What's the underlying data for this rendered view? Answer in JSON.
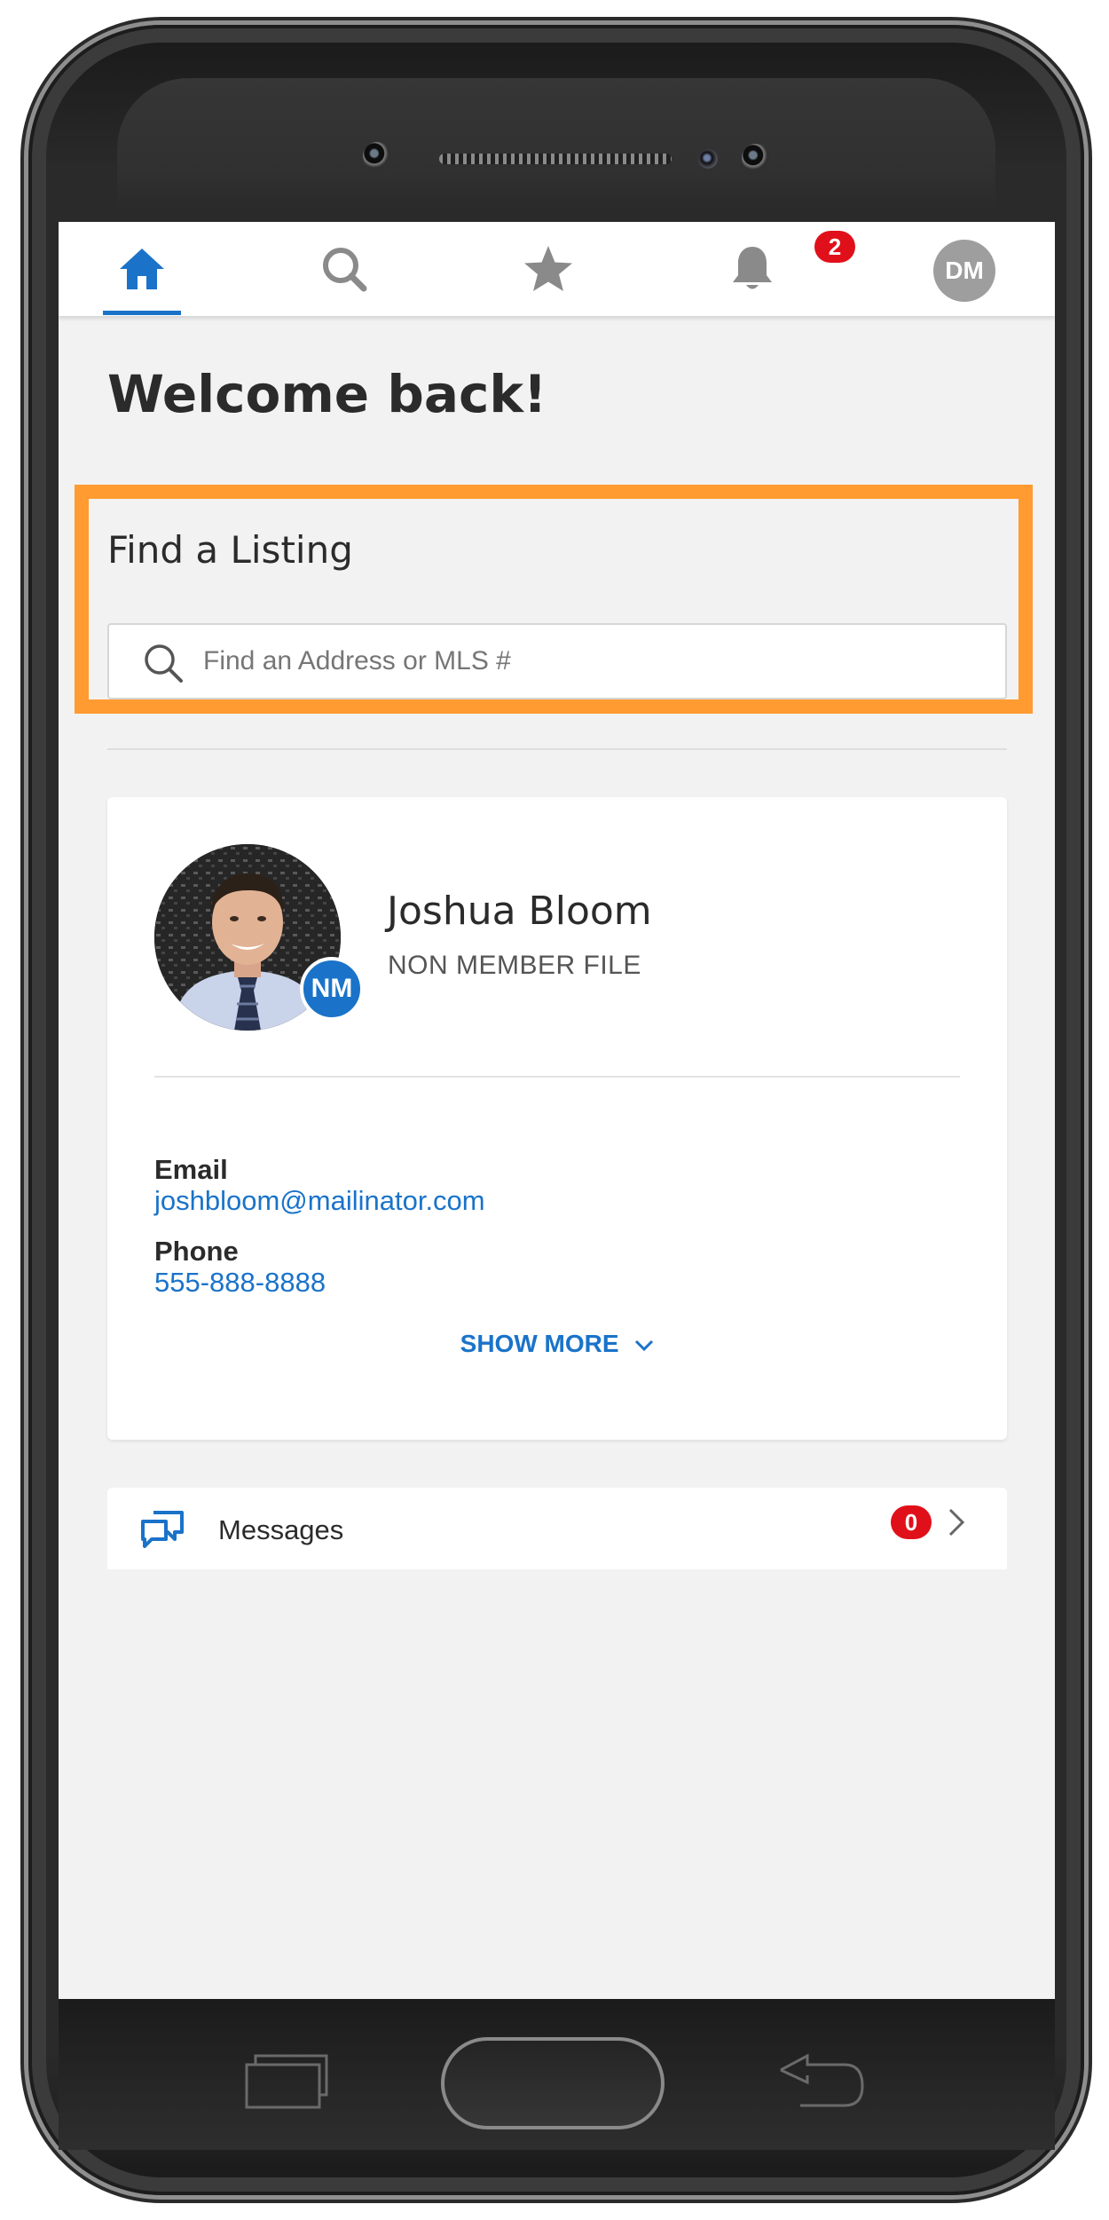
{
  "nav": {
    "items": [
      {
        "name": "home",
        "icon": "home-icon",
        "active": true
      },
      {
        "name": "search",
        "icon": "search-icon"
      },
      {
        "name": "favorites",
        "icon": "star-icon"
      },
      {
        "name": "notifications",
        "icon": "bell-icon"
      },
      {
        "name": "profile",
        "icon": "avatar"
      }
    ],
    "notification_count": "2",
    "avatar_initials": "DM",
    "accent_color": "#1a73c9",
    "badge_color": "#e0101a"
  },
  "welcome": "Welcome back!",
  "find_listing": {
    "title": "Find a Listing",
    "placeholder": "Find an Address or MLS #",
    "highlight_color": "#ff9b30"
  },
  "contact": {
    "name": "Joshua Bloom",
    "subtitle": "NON MEMBER FILE",
    "badge": "NM",
    "email_label": "Email",
    "email": "joshbloom@mailinator.com",
    "phone_label": "Phone",
    "phone": "555-888-8888",
    "show_more": "SHOW MORE"
  },
  "messages": {
    "label": "Messages",
    "count": "0",
    "icon": "chat-icon"
  },
  "hardware": {
    "buttons": [
      "recent-apps",
      "home",
      "back"
    ]
  }
}
